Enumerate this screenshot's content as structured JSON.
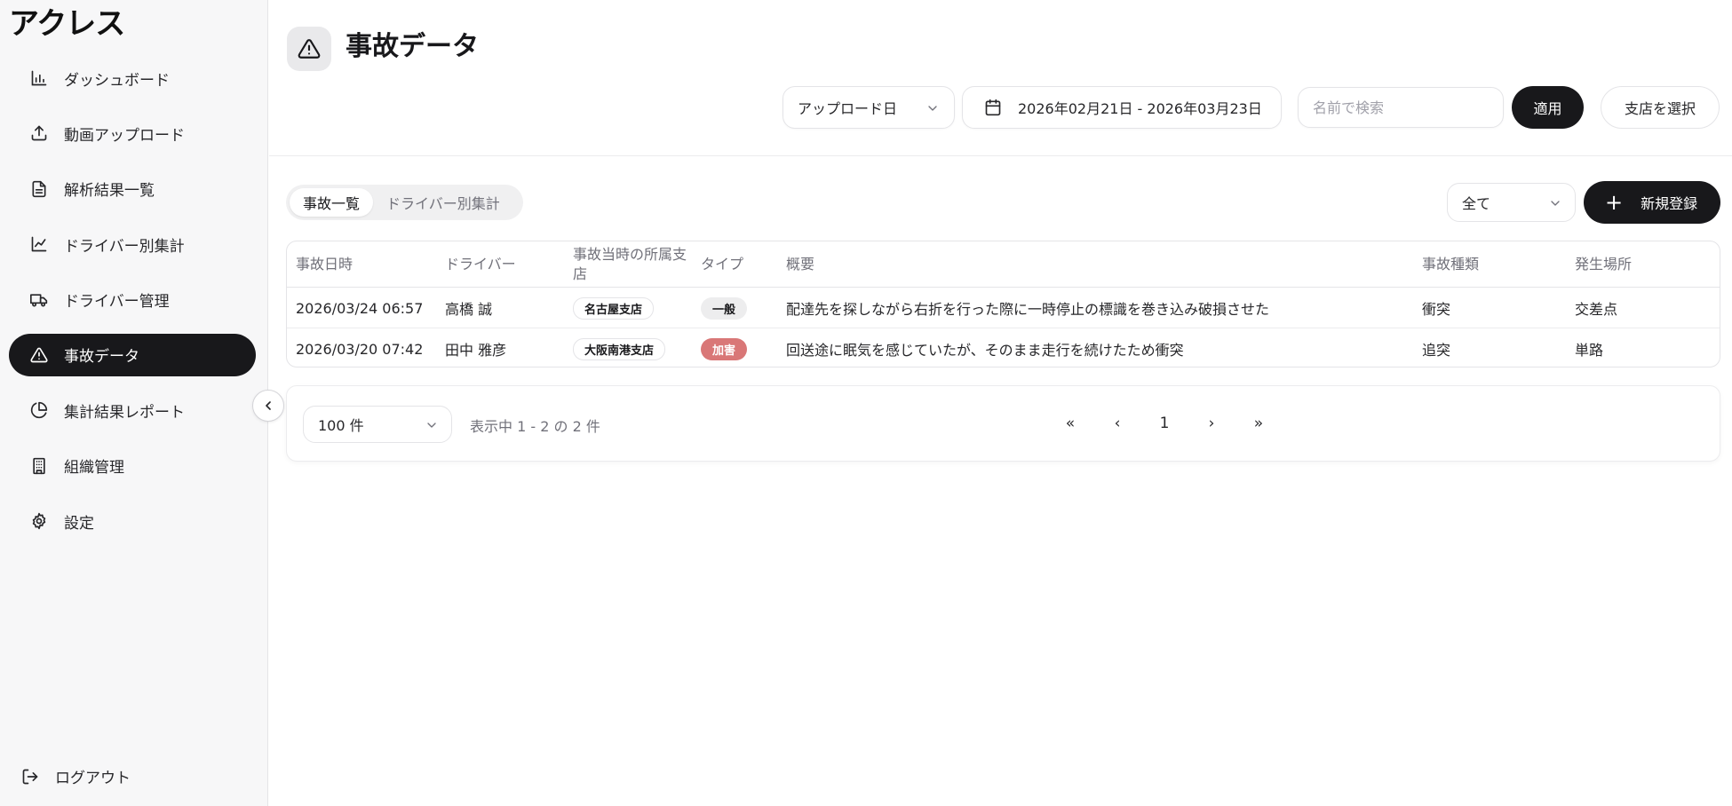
{
  "app": {
    "logo": "アクレス"
  },
  "sidebar": {
    "items": [
      {
        "label": "ダッシュボード",
        "icon": "bar-chart-icon"
      },
      {
        "label": "動画アップロード",
        "icon": "upload-icon"
      },
      {
        "label": "解析結果一覧",
        "icon": "document-icon"
      },
      {
        "label": "ドライバー別集計",
        "icon": "line-chart-icon"
      },
      {
        "label": "ドライバー管理",
        "icon": "truck-icon"
      },
      {
        "label": "事故データ",
        "icon": "warning-icon",
        "active": true
      },
      {
        "label": "集計結果レポート",
        "icon": "pie-chart-icon"
      },
      {
        "label": "組織管理",
        "icon": "building-icon"
      },
      {
        "label": "設定",
        "icon": "gear-icon"
      }
    ],
    "logout": "ログアウト"
  },
  "header": {
    "title": "事故データ",
    "date_type": "アップロード日",
    "date_range": "2026年02月21日 - 2026年03月23日",
    "search_placeholder": "名前で検索",
    "apply": "適用",
    "branch_select": "支店を選択"
  },
  "tabs": [
    {
      "label": "事故一覧",
      "active": true
    },
    {
      "label": "ドライバー別集計",
      "active": false
    }
  ],
  "filter": {
    "value": "全て"
  },
  "new_button": "新規登録",
  "table": {
    "columns": [
      "事故日時",
      "ドライバー",
      "事故当時の所属支店",
      "タイプ",
      "概要",
      "事故種類",
      "発生場所"
    ],
    "rows": [
      {
        "datetime": "2026/03/24 06:57",
        "driver": "高橋 誠",
        "branch": "名古屋支店",
        "type": "一般",
        "summary": "配達先を探しながら右折を行った際に一時停止の標識を巻き込み破損させた",
        "kind": "衝突",
        "place": "交差点"
      },
      {
        "datetime": "2026/03/20 07:42",
        "driver": "田中 雅彦",
        "branch": "大阪南港支店",
        "type": "加害",
        "summary": "回送途に眠気を感じていたが、そのまま走行を続けたため衝突",
        "kind": "追突",
        "place": "単路"
      }
    ]
  },
  "pagination": {
    "per_page": "100 件",
    "showing": "表示中 1 - 2 の 2 件",
    "first": "«",
    "prev": "‹",
    "current": "1",
    "next": "›",
    "last": "»"
  },
  "colors": {
    "primary": "#18181b",
    "harm_badge": "#d97777",
    "sidebar_bg": "#f7f7f8"
  }
}
